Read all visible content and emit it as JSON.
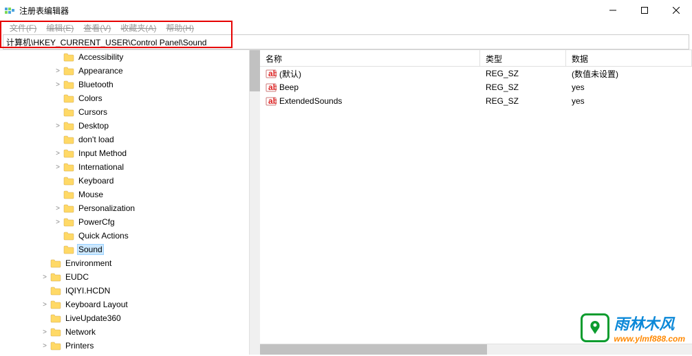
{
  "window": {
    "title": "注册表编辑器"
  },
  "menubar": {
    "file": "文件(F)",
    "edit": "编辑(E)",
    "view": "查看(V)",
    "favorites": "收藏夹(A)",
    "help": "帮助(H)"
  },
  "address": {
    "path": "计算机\\HKEY_CURRENT_USER\\Control Panel\\Sound"
  },
  "tree": {
    "items": [
      {
        "indent": 4,
        "expander": "",
        "label": "Accessibility"
      },
      {
        "indent": 4,
        "expander": ">",
        "label": "Appearance"
      },
      {
        "indent": 4,
        "expander": ">",
        "label": "Bluetooth"
      },
      {
        "indent": 4,
        "expander": "",
        "label": "Colors"
      },
      {
        "indent": 4,
        "expander": "",
        "label": "Cursors"
      },
      {
        "indent": 4,
        "expander": ">",
        "label": "Desktop"
      },
      {
        "indent": 4,
        "expander": "",
        "label": "don't load"
      },
      {
        "indent": 4,
        "expander": ">",
        "label": "Input Method"
      },
      {
        "indent": 4,
        "expander": ">",
        "label": "International"
      },
      {
        "indent": 4,
        "expander": "",
        "label": "Keyboard"
      },
      {
        "indent": 4,
        "expander": "",
        "label": "Mouse"
      },
      {
        "indent": 4,
        "expander": ">",
        "label": "Personalization"
      },
      {
        "indent": 4,
        "expander": ">",
        "label": "PowerCfg"
      },
      {
        "indent": 4,
        "expander": "",
        "label": "Quick Actions"
      },
      {
        "indent": 4,
        "expander": "",
        "label": "Sound",
        "selected": true
      },
      {
        "indent": 3,
        "expander": "",
        "label": "Environment"
      },
      {
        "indent": 3,
        "expander": ">",
        "label": "EUDC"
      },
      {
        "indent": 3,
        "expander": "",
        "label": "IQIYI.HCDN"
      },
      {
        "indent": 3,
        "expander": ">",
        "label": "Keyboard Layout"
      },
      {
        "indent": 3,
        "expander": "",
        "label": "LiveUpdate360"
      },
      {
        "indent": 3,
        "expander": ">",
        "label": "Network"
      },
      {
        "indent": 3,
        "expander": ">",
        "label": "Printers"
      }
    ]
  },
  "list": {
    "headers": {
      "name": "名称",
      "type": "类型",
      "data": "数据"
    },
    "rows": [
      {
        "name": "(默认)",
        "type": "REG_SZ",
        "data": "(数值未设置)"
      },
      {
        "name": "Beep",
        "type": "REG_SZ",
        "data": "yes"
      },
      {
        "name": "ExtendedSounds",
        "type": "REG_SZ",
        "data": "yes"
      }
    ]
  },
  "watermark": {
    "cn": "雨林木风",
    "url": "www.ylmf888.com"
  }
}
